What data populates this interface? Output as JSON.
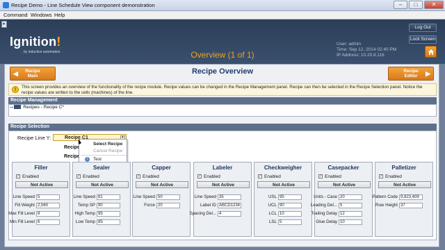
{
  "window": {
    "title": "Recipe Demo - Line Schedule View component demonstration"
  },
  "menu": {
    "items": [
      "Command",
      "Windows",
      "Help"
    ]
  },
  "header": {
    "logo": "Ignition",
    "logo_mark": "!",
    "logo_sub": "by inductive automation",
    "overview": "Overview (1 of 1)",
    "user_line": "User: admin",
    "time_line": "Time: Sep 12, 2014 02:40 PM",
    "ip_line": "IP Address: 10.20.8.116",
    "logout_label": "Log Out",
    "lockscreen_label": "Lock Screen"
  },
  "nav": {
    "left_label": "Recipe\nMain",
    "left_line1": "Recipe",
    "left_line2": "Main",
    "right_line1": "Recipe",
    "right_line2": "Editor"
  },
  "page": {
    "title": "Recipe Overview",
    "description": "This screen provides an overview of the functionality of the recipe module. Recipe values can be changed in the Recipe Management panel. Recipe can then be selected in the Recipe Selection panel. Notice the recipe values are written to the cells (machines) of the line."
  },
  "management": {
    "header": "Recipe Management",
    "tree_item": "Recipes - Recipe C*"
  },
  "selection": {
    "header": "Recipe Selection",
    "line_label": "Recipe Line Y:",
    "selected": "Recipe C1",
    "items": [
      "Recipe",
      "Recipe"
    ],
    "context_menu": [
      "Select Recipe",
      "Cancel Recipe",
      "Test"
    ]
  },
  "machines": [
    {
      "name": "Filler",
      "enabled_label": "Enabled",
      "state": "Not Active",
      "fields": [
        {
          "label": "Line Speed",
          "value": "5"
        },
        {
          "label": "Fill Weight",
          "value": "2,560"
        },
        {
          "label": "Max Fill Level",
          "value": "8"
        },
        {
          "label": "Min Fill Level",
          "value": "6"
        }
      ]
    },
    {
      "name": "Sealer",
      "enabled_label": "Enabled",
      "state": "Not Active",
      "fields": [
        {
          "label": "Line Speed",
          "value": "81"
        },
        {
          "label": "Temp SP",
          "value": "90"
        },
        {
          "label": "High Temp",
          "value": "95"
        },
        {
          "label": "Low Temp",
          "value": "85"
        }
      ]
    },
    {
      "name": "Capper",
      "enabled_label": "Enabled",
      "state": "Not Active",
      "fields": [
        {
          "label": "Line Speed",
          "value": "50"
        },
        {
          "label": "Force",
          "value": "20"
        }
      ]
    },
    {
      "name": "Labeler",
      "enabled_label": "Enabled",
      "state": "Not Active",
      "fields": [
        {
          "label": "Line Speed",
          "value": "35"
        },
        {
          "label": "Label ID",
          "value": "ABCD1234"
        },
        {
          "label": "Spacing Del...",
          "value": "4"
        }
      ]
    },
    {
      "name": "Checkweigher",
      "enabled_label": "Enabled",
      "state": "Not Active",
      "fields": [
        {
          "label": "USL",
          "value": "95"
        },
        {
          "label": "UCL",
          "value": "90"
        },
        {
          "label": "LCL",
          "value": "10"
        },
        {
          "label": "LSL",
          "value": "5"
        }
      ]
    },
    {
      "name": "Casepacker",
      "enabled_label": "Enabled",
      "state": "Not Active",
      "fields": [
        {
          "label": "Units - Case",
          "value": "20"
        },
        {
          "label": "Leading Del...",
          "value": "5"
        },
        {
          "label": "Trailing Delay",
          "value": "12"
        },
        {
          "label": "Glue Delay",
          "value": "10"
        }
      ]
    },
    {
      "name": "Palletizer",
      "enabled_label": "Enabled",
      "state": "Not Active",
      "fields": [
        {
          "label": "Pattern Code",
          "value": "9,823,409"
        },
        {
          "label": "Row Height",
          "value": "37"
        }
      ]
    }
  ],
  "colors": {
    "accent": "#f5a21a",
    "header_bg": "#2c3e58",
    "title_blue": "#1f3d6e"
  }
}
